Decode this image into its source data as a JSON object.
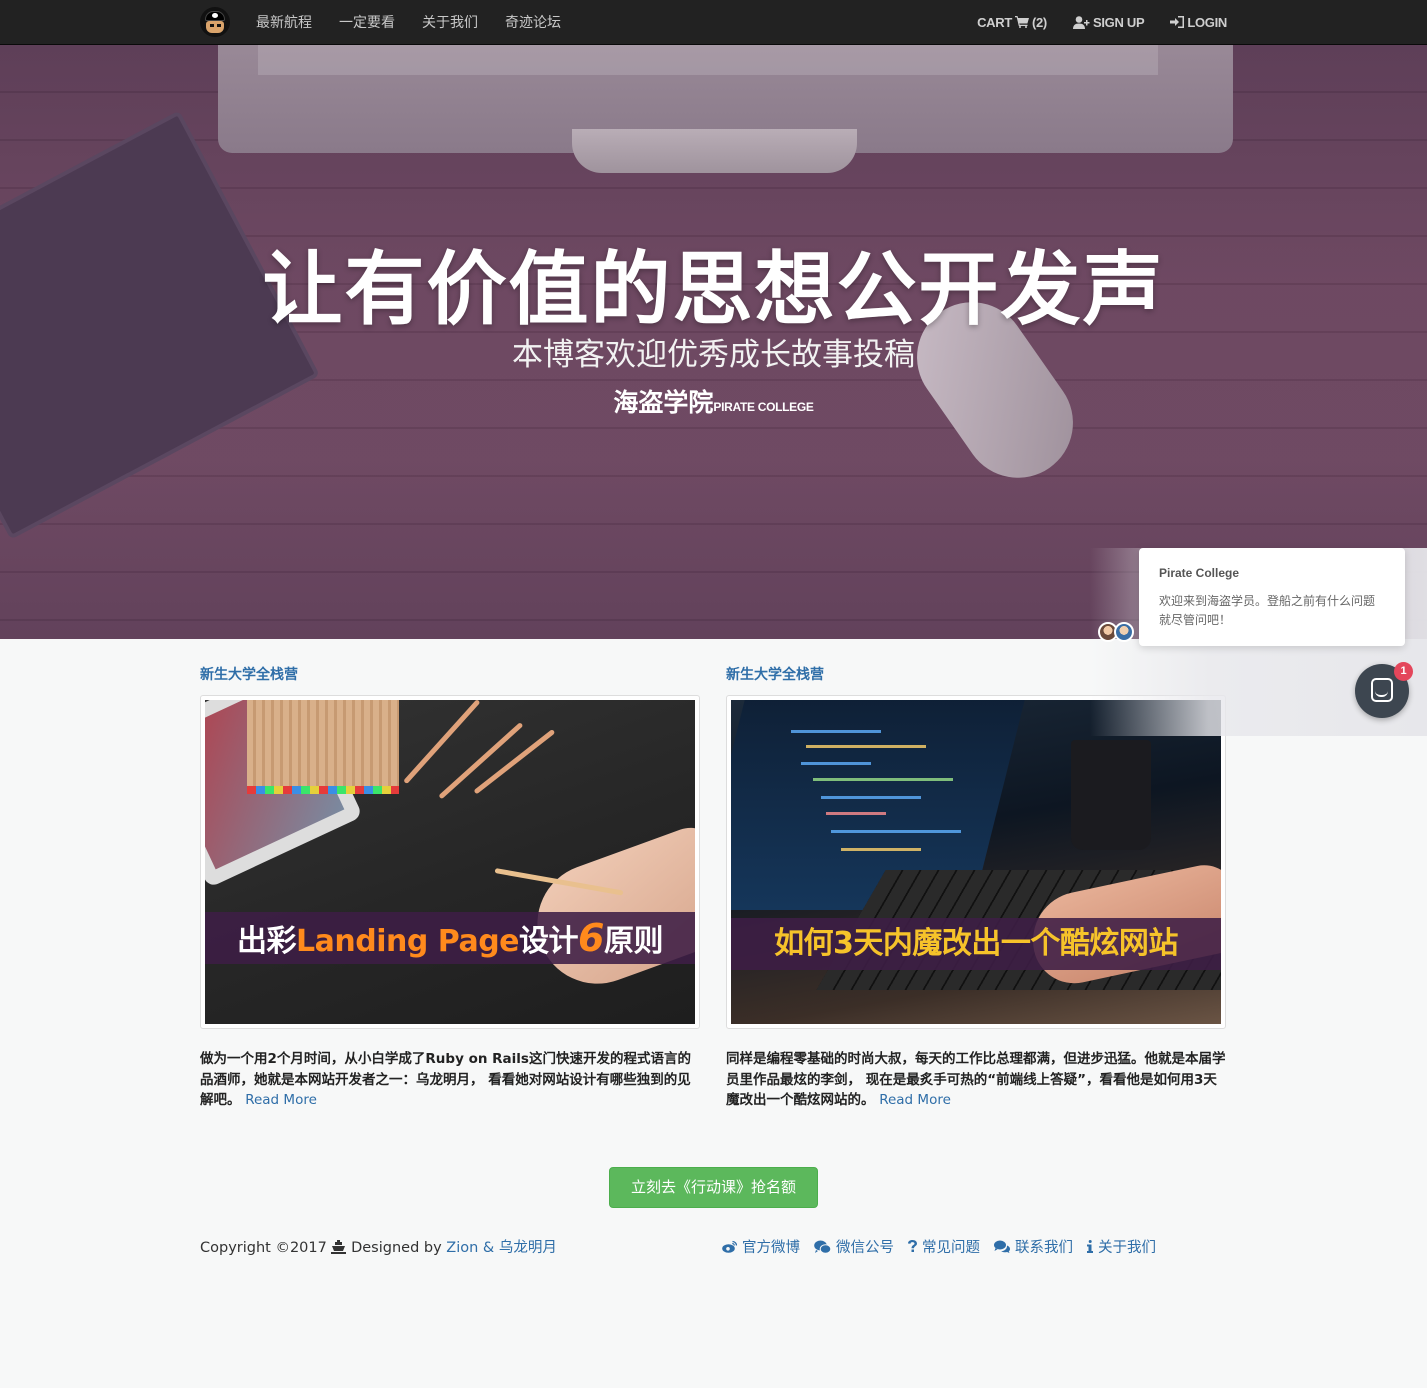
{
  "nav": {
    "links": [
      "最新航程",
      "一定要看",
      "关于我们",
      "奇迹论坛"
    ],
    "cart_label": "CART",
    "cart_count": "(2)",
    "signup_label": "SIGN UP",
    "login_label": "LOGIN"
  },
  "hero": {
    "title": "让有价值的思想公开发声",
    "subtitle": "本博客欢迎优秀成长故事投稿",
    "brand_cn": "海盗学院",
    "brand_en": "PIRATE COLLEGE"
  },
  "chat": {
    "from": "Pirate College",
    "message": "欢迎来到海盗学员。登船之前有什么问题就尽管问吧！",
    "badge": "1"
  },
  "posts": [
    {
      "category": "新生大学全栈营",
      "banner_pre": "出彩",
      "banner_hl1": "Landing Page",
      "banner_mid": "设计",
      "banner_hl2": "6",
      "banner_post": "原则",
      "excerpt": "做为一个用2个月时间，从小白学成了Ruby on Rails这门快速开发的程式语言的品酒师，她就是本网站开发者之一：乌龙明月， 看看她对网站设计有哪些独到的见解吧。",
      "read_more": "Read More"
    },
    {
      "category": "新生大学全栈营",
      "banner": "如何3天内魔改出一个酷炫网站",
      "excerpt": "同样是编程零基础的时尚大叔，每天的工作比总理都满，但进步迅猛。他就是本届学员里作品最炫的李剑， 现在是最炙手可热的“前端线上答疑”，看看他是如何用3天魔改出一个酷炫网站的。",
      "read_more": "Read More"
    }
  ],
  "cta": "立刻去《行动课》抢名额",
  "footer": {
    "copyright_pre": "Copyright ©2017",
    "designed_by": "Designed by",
    "designers": "Zion & 乌龙明月",
    "links": [
      "官方微博",
      "微信公号",
      "常见问题",
      "联系我们",
      "关于我们"
    ]
  },
  "colors": {
    "navbar": "#222222",
    "link": "#2f6ea8",
    "cta": "#5cb85c",
    "badge": "#e4465b",
    "accent_orange": "#ff8a1c",
    "accent_yellow": "#f6c32a"
  },
  "icons": [
    "pirate-logo-icon",
    "cart-icon",
    "user-plus-icon",
    "sign-in-icon",
    "ship-icon",
    "weibo-icon",
    "wechat-icon",
    "question-icon",
    "comments-icon",
    "info-icon",
    "chat-bubble-icon"
  ]
}
